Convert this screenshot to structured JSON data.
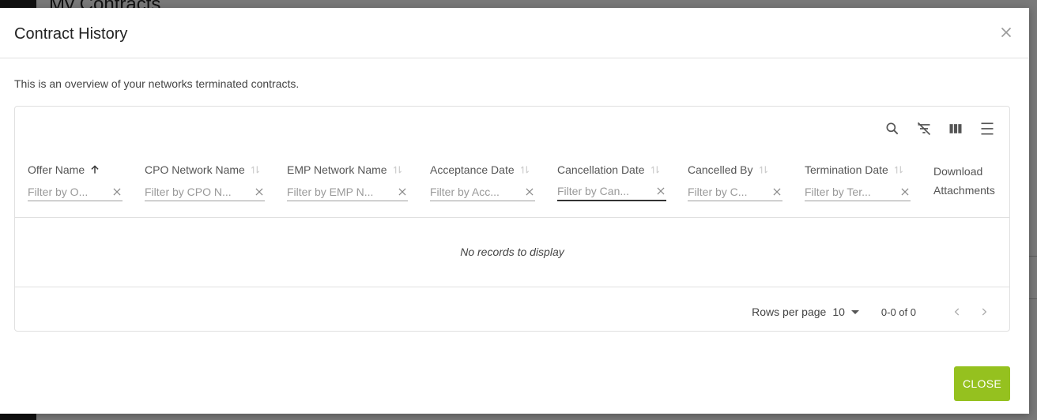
{
  "background": {
    "page_title": "My Contracts"
  },
  "modal": {
    "title": "Contract History",
    "description": "This is an overview of your networks terminated contracts.",
    "close_button": "CLOSE"
  },
  "table": {
    "columns": [
      {
        "label": "Offer Name",
        "placeholder": "Filter by O...",
        "sort": "asc"
      },
      {
        "label": "CPO Network Name",
        "placeholder": "Filter by CPO N...",
        "sort": "none"
      },
      {
        "label": "EMP Network Name",
        "placeholder": "Filter by EMP N...",
        "sort": "none"
      },
      {
        "label": "Acceptance Date",
        "placeholder": "Filter by Acc...",
        "sort": "none"
      },
      {
        "label": "Cancellation Date",
        "placeholder": "Filter by Can...",
        "sort": "none"
      },
      {
        "label": "Cancelled By",
        "placeholder": "Filter by C...",
        "sort": "none"
      },
      {
        "label": "Termination Date",
        "placeholder": "Filter by Ter...",
        "sort": "none"
      }
    ],
    "download_column": {
      "line1": "Download",
      "line2": "Attachments"
    },
    "empty_message": "No records to display",
    "toolbar_icons": [
      "search-icon",
      "filter-off-icon",
      "view-column-icon",
      "density-icon"
    ]
  },
  "pagination": {
    "rows_per_page_label": "Rows per page",
    "rows_per_page_value": "10",
    "range_text": "0-0 of 0"
  },
  "colors": {
    "accent": "#95c11f"
  }
}
